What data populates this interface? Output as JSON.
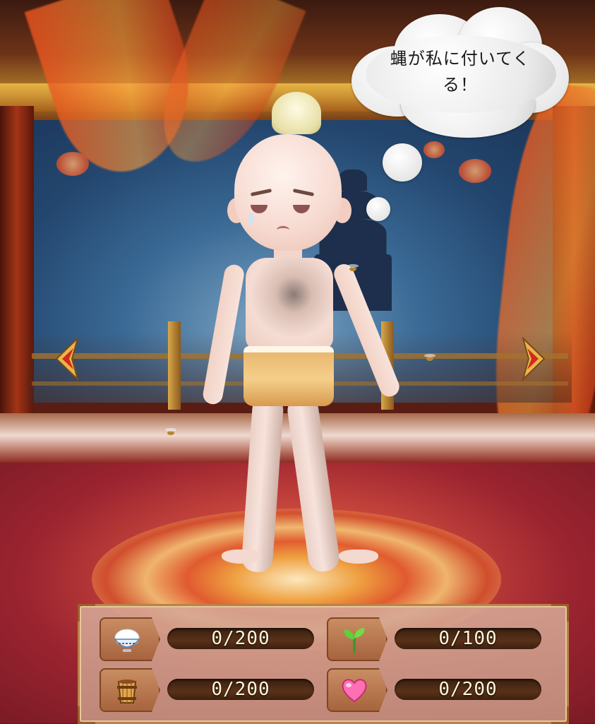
{
  "speech_bubble": {
    "text": "蝿が私に付いてく\nる！"
  },
  "navigation": {
    "prev_icon": "arrow-left-icon",
    "next_icon": "arrow-right-icon"
  },
  "stats": [
    {
      "id": "food",
      "icon": "rice-bowl-icon",
      "value_label": "0/200",
      "current": 0,
      "max": 200
    },
    {
      "id": "growth",
      "icon": "sprout-icon",
      "value_label": "0/100",
      "current": 0,
      "max": 100
    },
    {
      "id": "cleanliness",
      "icon": "wooden-bucket-icon",
      "value_label": "0/200",
      "current": 0,
      "max": 200
    },
    {
      "id": "affection",
      "icon": "heart-icon",
      "value_label": "0/200",
      "current": 0,
      "max": 200
    }
  ],
  "colors": {
    "panel_border": "#b9824a",
    "bar_bg": "#4a2814",
    "bar_text": "#fff6da",
    "arrow_red": "#d12a1f",
    "arrow_gold": "#e9b64a"
  }
}
